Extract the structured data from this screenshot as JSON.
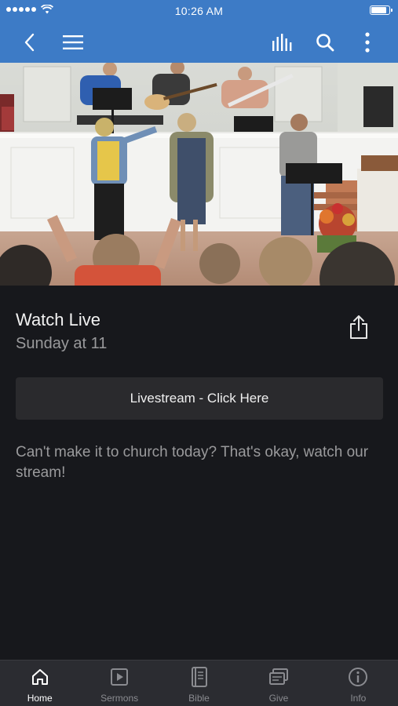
{
  "status_bar": {
    "time": "10:26 AM",
    "battery_level": 0.9
  },
  "nav": {
    "icons": [
      "back-icon",
      "menu-icon",
      "audio-bars-icon",
      "search-icon",
      "more-vert-icon"
    ]
  },
  "hero": {
    "image_description_icon": "worship-band-photo"
  },
  "main": {
    "title": "Watch Live",
    "subtitle": "Sunday at 11",
    "button_label": "Livestream - Click Here",
    "description": "Can't make it to church today? That's okay, watch our stream!"
  },
  "tabs": [
    {
      "label": "Home",
      "icon": "home-icon",
      "active": true
    },
    {
      "label": "Sermons",
      "icon": "play-icon",
      "active": false
    },
    {
      "label": "Bible",
      "icon": "book-icon",
      "active": false
    },
    {
      "label": "Give",
      "icon": "give-icon",
      "active": false
    },
    {
      "label": "Info",
      "icon": "info-icon",
      "active": false
    }
  ],
  "colors": {
    "accent": "#3d7bc6",
    "background": "#17181c",
    "tabbar": "#2b2c31",
    "button": "#2a2a2d"
  }
}
